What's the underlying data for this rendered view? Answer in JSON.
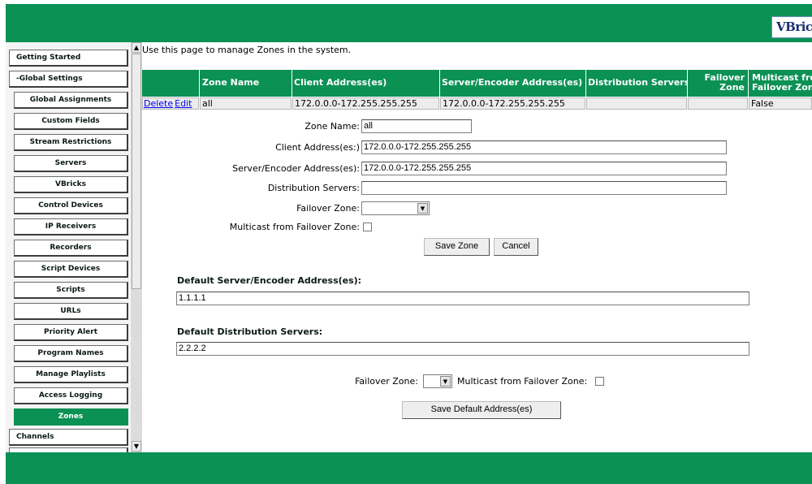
{
  "header": {
    "logo_text": "VBricks"
  },
  "sidebar": {
    "items": [
      {
        "label": "Getting Started"
      },
      {
        "label": "-Global Settings"
      },
      {
        "label": "Global Assignments"
      },
      {
        "label": "Custom Fields"
      },
      {
        "label": "Stream Restrictions"
      },
      {
        "label": "Servers"
      },
      {
        "label": "VBricks"
      },
      {
        "label": "Control Devices"
      },
      {
        "label": "IP Receivers"
      },
      {
        "label": "Recorders"
      },
      {
        "label": "Script Devices"
      },
      {
        "label": "Scripts"
      },
      {
        "label": "URLs"
      },
      {
        "label": "Priority Alert"
      },
      {
        "label": "Program Names"
      },
      {
        "label": "Manage Playlists"
      },
      {
        "label": "Access Logging"
      },
      {
        "label": "Zones"
      },
      {
        "label": "Channels"
      }
    ],
    "scroll_up_glyph": "▲",
    "scroll_down_glyph": "▼"
  },
  "intro": "Use this page to manage Zones in the system.",
  "zones_table": {
    "headers": {
      "zone_name": "Zone Name",
      "client_address": "Client Address(es)",
      "server_address": "Server/Encoder Address(es)",
      "distribution_servers": "Distribution Servers",
      "failover_zone_l1": "Failover",
      "failover_zone_l2": "Zone",
      "multicast_l1": "Multicast from",
      "multicast_l2": "Failover Zone"
    },
    "row": {
      "delete_link": "Delete",
      "edit_link": "Edit",
      "zone_name": "all",
      "client_address": "172.0.0.0-172.255.255.255",
      "server_address": "172.0.0.0-172.255.255.255",
      "distribution_servers": "",
      "failover_zone": "",
      "multicast": "False"
    }
  },
  "zone_form": {
    "zone_name_label": "Zone Name:",
    "zone_name_value": "all",
    "client_address_label": "Client Address(es:)",
    "client_address_value": "172.0.0.0-172.255.255.255",
    "server_address_label": "Server/Encoder Address(es):",
    "server_address_value": "172.0.0.0-172.255.255.255",
    "distribution_servers_label": "Distribution Servers:",
    "distribution_servers_value": "",
    "failover_zone_label": "Failover Zone:",
    "failover_zone_value": "",
    "multicast_label": "Multicast from Failover Zone:",
    "save_button": "Save Zone",
    "cancel_button": "Cancel"
  },
  "defaults": {
    "server_heading": "Default Server/Encoder Address(es):",
    "server_value": "1.1.1.1",
    "distribution_heading": "Default Distribution Servers:",
    "distribution_value": "2.2.2.2",
    "failover_zone_label": "Failover Zone:",
    "failover_zone_value": "",
    "multicast_label": "Multicast from Failover Zone:",
    "save_button": "Save Default Address(es)"
  },
  "dropdown_glyph": "▼",
  "colors": {
    "brand_green": "#0b9154",
    "link_blue": "#0000ee"
  }
}
